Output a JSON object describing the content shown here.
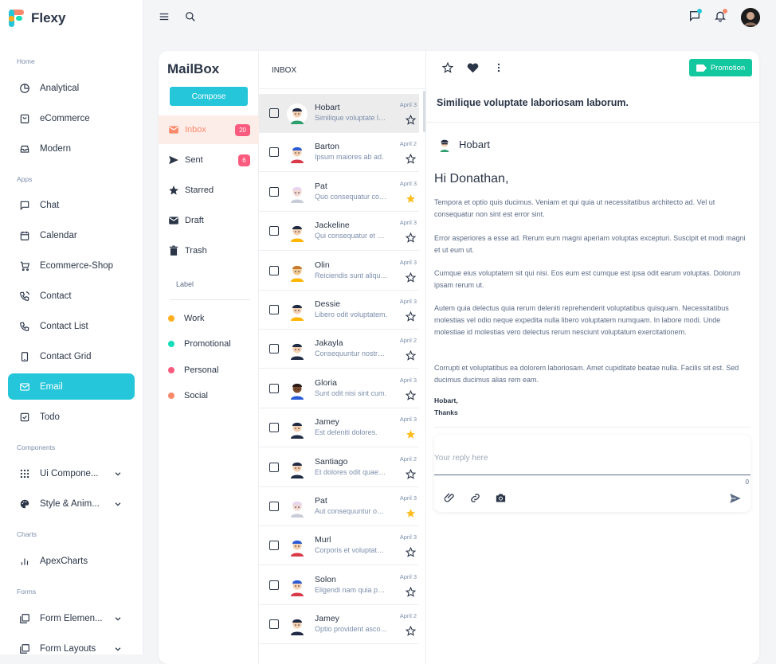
{
  "brand": {
    "name": "Flexy"
  },
  "sidebar": {
    "sections": [
      {
        "title": "Home",
        "items": [
          {
            "label": "Analytical",
            "icon": "pie-chart-icon"
          },
          {
            "label": "eCommerce",
            "icon": "shopping-bag-icon"
          },
          {
            "label": "Modern",
            "icon": "inbox-tray-icon"
          }
        ]
      },
      {
        "title": "Apps",
        "items": [
          {
            "label": "Chat",
            "icon": "message-icon"
          },
          {
            "label": "Calendar",
            "icon": "calendar-icon"
          },
          {
            "label": "Ecommerce-Shop",
            "icon": "cart-icon"
          },
          {
            "label": "Contact",
            "icon": "phone-ring-icon"
          },
          {
            "label": "Contact List",
            "icon": "phone-icon"
          },
          {
            "label": "Contact Grid",
            "icon": "device-icon"
          },
          {
            "label": "Email",
            "icon": "mail-icon",
            "active": true
          },
          {
            "label": "Todo",
            "icon": "checkbox-icon"
          }
        ]
      },
      {
        "title": "Components",
        "items": [
          {
            "label": "Ui Compone...",
            "icon": "grid-icon"
          },
          {
            "label": "Style & Anim...",
            "icon": "palette-icon"
          }
        ]
      },
      {
        "title": "Charts",
        "items": [
          {
            "label": "ApexCharts",
            "icon": "bar-chart-icon"
          }
        ]
      },
      {
        "title": "Forms",
        "items": [
          {
            "label": "Form Elemen...",
            "icon": "form-icon"
          },
          {
            "label": "Form Layouts",
            "icon": "layout-icon"
          }
        ]
      }
    ]
  },
  "mailbox": {
    "title": "MailBox",
    "compose_label": "Compose",
    "folders": [
      {
        "label": "Inbox",
        "badge": "20",
        "active": true
      },
      {
        "label": "Sent",
        "badge": "6"
      },
      {
        "label": "Starred"
      },
      {
        "label": "Draft"
      },
      {
        "label": "Trash"
      }
    ],
    "label_title": "Label",
    "labels": [
      {
        "label": "Work",
        "color": "#ffae1f"
      },
      {
        "label": "Promotional",
        "color": "#13deb9"
      },
      {
        "label": "Personal",
        "color": "#fa5a7d"
      },
      {
        "label": "Social",
        "color": "#fa896b"
      }
    ]
  },
  "list": {
    "header": "INBOX",
    "emails": [
      {
        "name": "Hobart",
        "snippet": "Similique voluptate laboriosam laborum.",
        "date": "April 3",
        "starred": false,
        "selected": true
      },
      {
        "name": "Barton",
        "snippet": "Ipsum maiores ab ad.",
        "date": "April 2",
        "starred": false
      },
      {
        "name": "Pat",
        "snippet": "Quo consequatur consequatur.",
        "date": "April 3",
        "starred": true
      },
      {
        "name": "Jackeline",
        "snippet": "Qui consequatur et dolores.",
        "date": "April 3",
        "starred": false
      },
      {
        "name": "Olin",
        "snippet": "Reiciendis sunt aliquam.",
        "date": "April 3",
        "starred": false
      },
      {
        "name": "Dessie",
        "snippet": "Libero odit voluptatem.",
        "date": "April 3",
        "starred": false
      },
      {
        "name": "Jakayla",
        "snippet": "Consequuntur nostrum.",
        "date": "April 2",
        "starred": false
      },
      {
        "name": "Gloria",
        "snippet": "Sunt odit nisi sint cum.",
        "date": "April 3",
        "starred": false
      },
      {
        "name": "Jamey",
        "snippet": "Est deleniti dolores.",
        "date": "April 3",
        "starred": true
      },
      {
        "name": "Santiago",
        "snippet": "Et dolores odit quaerat.",
        "date": "April 2",
        "starred": false
      },
      {
        "name": "Pat",
        "snippet": "Aut consequuntur odio.",
        "date": "April 3",
        "starred": true
      },
      {
        "name": "Murl",
        "snippet": "Corporis et voluptatem.",
        "date": "April 3",
        "starred": false
      },
      {
        "name": "Solon",
        "snippet": "Eligendi nam quia porro.",
        "date": "April 3",
        "starred": false
      },
      {
        "name": "Jamey",
        "snippet": "Optio provident ascorum.",
        "date": "April 2",
        "starred": false
      }
    ]
  },
  "detail": {
    "promo_label": "Promotion",
    "subject": "Similique voluptate laboriosam laborum.",
    "from": "Hobart",
    "greeting": "Hi Donathan,",
    "paragraphs": [
      "Tempora et optio quis ducimus. Veniam et qui quia ut necessitatibus architecto ad. Vel ut consequatur non sint est error sint.",
      "Error asperiores a esse ad. Rerum eum magni aperiam voluptas excepturi. Suscipit et modi magni et ut eum ut.",
      "Cumque eius voluptatem sit qui nisi. Eos eum est cumque est ipsa odit earum voluptas. Dolorum ipsam rerum ut.",
      "Autem quia delectus quia rerum deleniti reprehenderit voluptatibus quisquam. Necessitatibus molestias vel odio neque expedita nulla libero voluptatem numquam. In labore modi. Unde molestiae id molestias vero delectus rerum nesciunt voluptatum exercitationem.",
      "Corrupti et voluptatibus ea dolorem laboriosam. Amet cupiditate beatae nulla. Facilis sit est. Sed ducimus ducimus alias rem eam."
    ],
    "signature_name": "Hobart,",
    "signature_thanks": "Thanks",
    "reply_placeholder": "Your reply here",
    "reply_count": "0"
  },
  "colors": {
    "accent": "#26c6da",
    "promo": "#13c79f",
    "star": "#ffbd1f"
  }
}
